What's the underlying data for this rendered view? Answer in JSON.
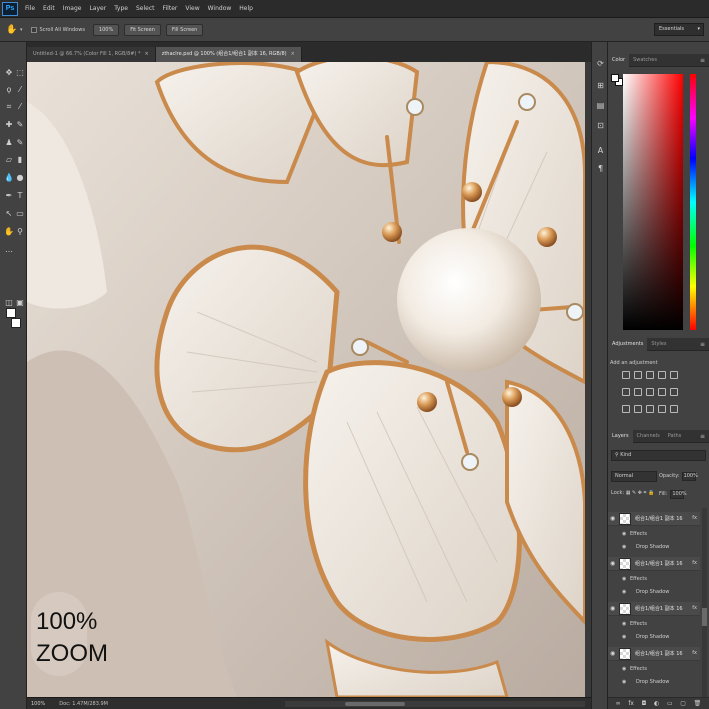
{
  "app": {
    "logo": "Ps",
    "menu": [
      "File",
      "Edit",
      "Image",
      "Layer",
      "Type",
      "Select",
      "Filter",
      "View",
      "Window",
      "Help"
    ]
  },
  "options": {
    "scroll_all_label": "Scroll All Windows",
    "buttons": [
      "100%",
      "Fit Screen",
      "Fill Screen"
    ],
    "workspace": "Essentials"
  },
  "tabs": [
    {
      "label": "Untitled-1 @ 66.7% (Color Fill 1, RGB/8#) *",
      "active": false
    },
    {
      "label": "zthaclre.psd @ 100% (组合1/组合1 副本 16, RGB/8)",
      "active": true
    }
  ],
  "canvas": {
    "overlay_line1": "100%",
    "overlay_line2": "ZOOM"
  },
  "status": {
    "zoom": "100%",
    "doc": "Doc: 1.47M/283.9M"
  },
  "panels": {
    "color_tabs": [
      "Color",
      "Swatches"
    ],
    "adjustments_tabs": [
      "Adjustments",
      "Styles"
    ],
    "adjustments_title": "Add an adjustment",
    "layers_tabs": [
      "Layers",
      "Channels",
      "Paths"
    ],
    "layer_filter": "Kind",
    "blend_mode": "Normal",
    "opacity_label": "Opacity:",
    "opacity_value": "100%",
    "lock_label": "Lock:",
    "fill_label": "Fill:",
    "fill_value": "100%",
    "layers": [
      {
        "name": "组合1/组合1 副本 16",
        "effects": [
          "Effects",
          "Drop Shadow"
        ]
      },
      {
        "name": "组合1/组合1 副本 16",
        "effects": [
          "Effects",
          "Drop Shadow"
        ]
      },
      {
        "name": "组合1/组合1 副本 16",
        "effects": [
          "Effects",
          "Drop Shadow"
        ]
      },
      {
        "name": "组合1/组合1 副本 16",
        "effects": [
          "Effects",
          "Drop Shadow"
        ]
      }
    ]
  },
  "icons": {
    "eye": "visibility-eye-icon",
    "fx": "fx-icon",
    "panel_menu": "panel-menu-icon"
  },
  "colors": {
    "accent": "#31a8ff",
    "ui_dark": "#424242",
    "gold": "#c98a4c",
    "pearl": "#f2ebe2"
  }
}
